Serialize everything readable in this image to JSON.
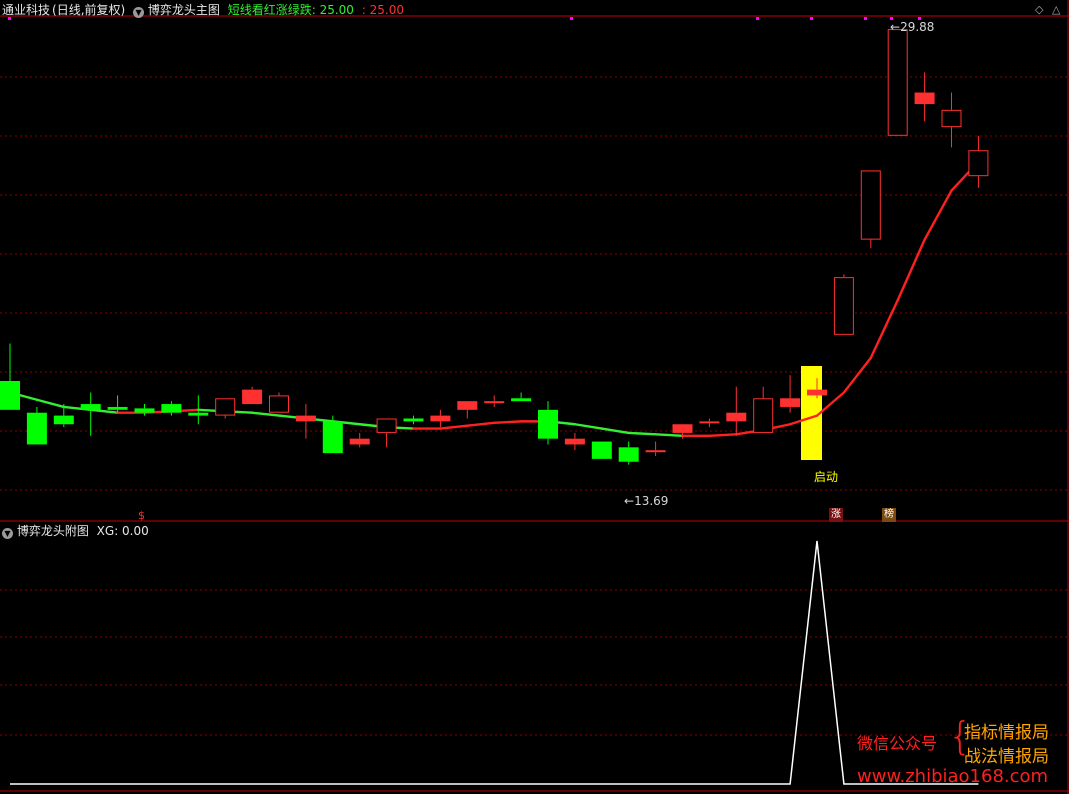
{
  "main_header": {
    "stock": "通业科技",
    "period": "(日线,前复权)",
    "indicator": "博弈龙头主图",
    "formula_label": "短线看红涨绿跌:",
    "value_green": "25.00",
    "value_red": "25.00"
  },
  "sub_header": {
    "indicator": "博弈龙头附图",
    "value_label": "XG: 0.00"
  },
  "markers": {
    "high_label": "29.88",
    "low_label": "13.69",
    "start_label": "启动",
    "dollar_label": "$",
    "zhang_label": "涨",
    "bang_label": "榜"
  },
  "watermark": {
    "left": "微信公众号",
    "line1": "指标情报局",
    "line2": "战法情报局",
    "url": "www.zhibiao168.com"
  },
  "colors": {
    "background": "#000000",
    "up": "#ff3030",
    "down": "#00ff00",
    "frame": "#c00000",
    "grid": "#8b0000",
    "signal": "#ffff00",
    "ma_rising": "#ff2020",
    "ma_falling": "#33ee33",
    "xg_line": "#ffffff",
    "dot": "#ff00ff"
  },
  "chart_data": [
    {
      "type": "candlestick",
      "title": "博弈龙头主图",
      "y_unit": "price",
      "ylim": [
        12.5,
        30.5
      ],
      "series": [
        {
          "name": "candles",
          "ohlc": [
            [
              17.4,
              18.7,
              16.4,
              16.4
            ],
            [
              16.3,
              16.5,
              15.2,
              15.2
            ],
            [
              16.2,
              16.6,
              15.8,
              15.9
            ],
            [
              16.6,
              17.0,
              15.5,
              16.4
            ],
            [
              16.5,
              16.9,
              16.3,
              16.4
            ],
            [
              16.45,
              16.6,
              16.2,
              16.3
            ],
            [
              16.6,
              16.7,
              16.2,
              16.3
            ],
            [
              16.3,
              16.9,
              15.9,
              16.2
            ],
            [
              16.2,
              16.8,
              16.1,
              16.8
            ],
            [
              16.6,
              17.2,
              16.6,
              17.1
            ],
            [
              16.3,
              17.0,
              16.3,
              16.9
            ],
            [
              16.0,
              16.6,
              15.4,
              16.2
            ],
            [
              16.0,
              16.2,
              14.9,
              14.9
            ],
            [
              15.2,
              15.6,
              15.1,
              15.4
            ],
            [
              15.6,
              15.9,
              15.1,
              16.1
            ],
            [
              16.1,
              16.2,
              15.9,
              16.0
            ],
            [
              16.0,
              16.4,
              15.8,
              16.2
            ],
            [
              16.4,
              16.7,
              16.1,
              16.7
            ],
            [
              16.7,
              16.9,
              16.5,
              16.7
            ],
            [
              16.8,
              17.0,
              16.7,
              16.7
            ],
            [
              16.4,
              16.7,
              15.2,
              15.4
            ],
            [
              15.2,
              15.6,
              15.0,
              15.4
            ],
            [
              15.3,
              15.3,
              14.7,
              14.7
            ],
            [
              15.1,
              15.3,
              14.5,
              14.6
            ],
            [
              15.0,
              15.3,
              14.8,
              15.0
            ],
            [
              15.6,
              15.7,
              15.4,
              15.9
            ],
            [
              16.0,
              16.1,
              15.8,
              16.0
            ],
            [
              16.0,
              17.2,
              15.5,
              16.3
            ],
            [
              15.6,
              17.2,
              15.6,
              16.8
            ],
            [
              16.5,
              17.6,
              16.3,
              16.8
            ],
            [
              16.9,
              17.5,
              16.8,
              17.1
            ],
            [
              19.0,
              21.1,
              19.0,
              21.0
            ],
            [
              22.3,
              24.3,
              22.0,
              24.7
            ],
            [
              25.9,
              27.2,
              25.9,
              29.6
            ],
            [
              27.0,
              28.1,
              26.4,
              27.4
            ],
            [
              26.2,
              27.4,
              25.5,
              26.8
            ],
            [
              24.5,
              25.9,
              24.1,
              25.4
            ]
          ]
        },
        {
          "name": "trend",
          "values": [
            17.0,
            16.75,
            16.5,
            16.4,
            16.3,
            16.3,
            16.35,
            16.4,
            16.35,
            16.3,
            16.2,
            16.1,
            16.0,
            15.9,
            15.8,
            15.75,
            15.75,
            15.85,
            15.95,
            16.0,
            16.0,
            15.9,
            15.75,
            15.6,
            15.55,
            15.5,
            15.5,
            15.55,
            15.7,
            15.9,
            16.2,
            17.0,
            18.2,
            20.2,
            22.3,
            24.0,
            25.0
          ]
        }
      ],
      "annotations": [
        "29.88",
        "13.69",
        "启动",
        "涨",
        "榜",
        "$"
      ]
    },
    {
      "type": "line",
      "title": "博弈龙头附图",
      "series": [
        {
          "name": "XG",
          "values": [
            0,
            0,
            0,
            0,
            0,
            0,
            0,
            0,
            0,
            0,
            0,
            0,
            0,
            0,
            0,
            0,
            0,
            0,
            0,
            0,
            0,
            0,
            0,
            0,
            0,
            0,
            0,
            0,
            0,
            0,
            1,
            0,
            0,
            0,
            0,
            0,
            0
          ]
        }
      ],
      "ylim": [
        0,
        1
      ]
    }
  ]
}
